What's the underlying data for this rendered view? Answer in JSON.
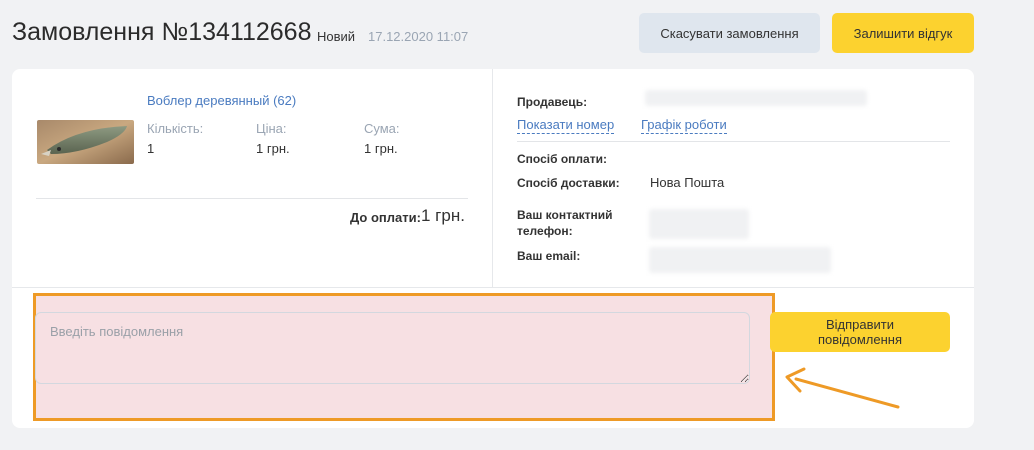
{
  "header": {
    "title": "Замовлення №134112668",
    "status": "Новий",
    "date": "17.12.2020 11:07",
    "cancel_label": "Скасувати замовлення",
    "review_label": "Залишити відгук"
  },
  "product": {
    "name": "Воблер деревянный (62)",
    "quantity_label": "Кількість:",
    "quantity": "1",
    "price_label": "Ціна:",
    "price": "1 грн.",
    "sum_label": "Сума:",
    "sum": "1 грн.",
    "total_label": "До оплати:",
    "total": "1 грн."
  },
  "seller": {
    "seller_label": "Продавець:",
    "show_phone_link": "Показати номер",
    "schedule_link": "Графік роботи",
    "payment_label": "Спосіб оплати:",
    "delivery_label": "Спосіб доставки:",
    "delivery_value": "Нова Пошта",
    "phone_label": "Ваш контактний телефон:",
    "email_label": "Ваш email:"
  },
  "message": {
    "placeholder": "Введіть повідомлення",
    "send_label": "Відправити повідомлення"
  },
  "colors": {
    "accent_yellow": "#fcd22f",
    "highlight_border": "#ee9a26",
    "link_blue": "#4a7bc0"
  }
}
